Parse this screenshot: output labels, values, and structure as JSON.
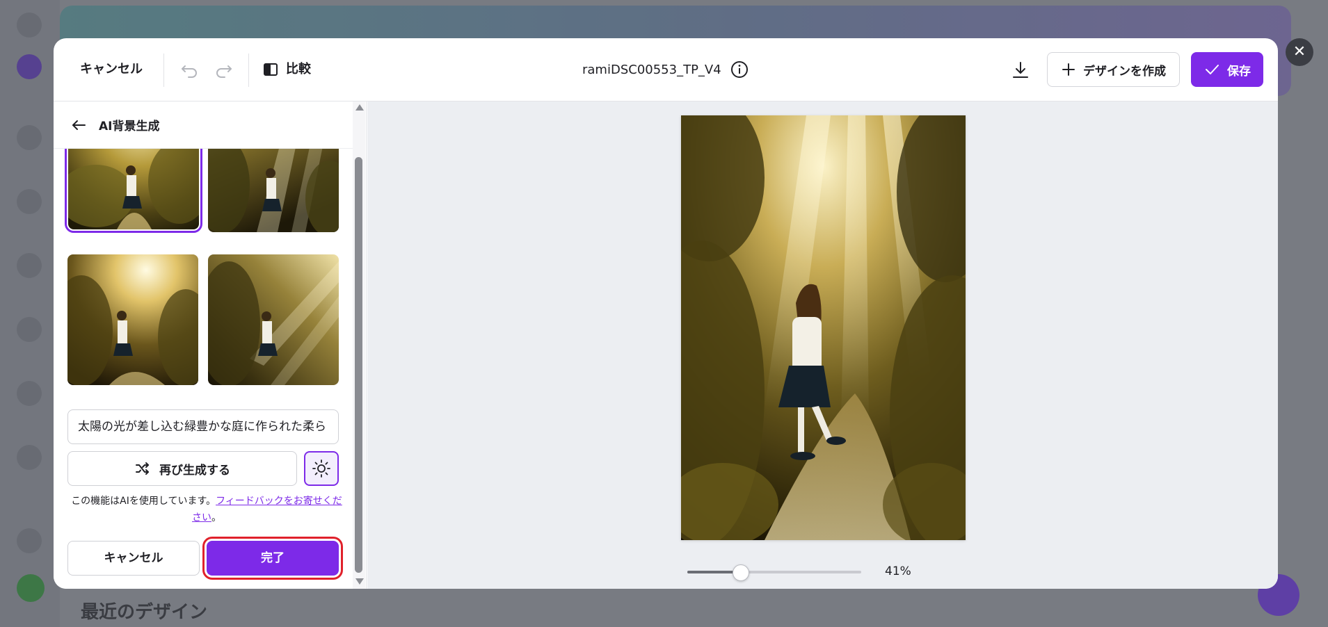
{
  "background": {
    "heading": "最近のデザイン"
  },
  "topbar": {
    "cancel_label": "キャンセル",
    "compare_label": "比較",
    "file_title": "ramiDSC00553_TP_V4",
    "create_design_label": "デザインを作成",
    "save_label": "保存"
  },
  "panel": {
    "title": "AI背景生成",
    "thumbnails": [
      {
        "label": "variation-1",
        "selected": true
      },
      {
        "label": "variation-2",
        "selected": false
      },
      {
        "label": "variation-3",
        "selected": false
      },
      {
        "label": "variation-4",
        "selected": false
      }
    ],
    "prompt_value": "太陽の光が差し込む緑豊かな庭に作られた柔ら",
    "regenerate_label": "再び生成する",
    "ai_note_text": "この機能はAIを使用しています。",
    "feedback_link": "フィードバックをお寄せください",
    "ai_note_end": "。",
    "cancel_label": "キャンセル",
    "done_label": "完了"
  },
  "canvas": {
    "zoom_label": "41%",
    "zoom_level": 0.41
  },
  "colors": {
    "accent": "#7d2ae8",
    "highlight": "#e0212b"
  },
  "icons": {
    "close": "close-icon",
    "undo": "undo-icon",
    "redo": "redo-icon",
    "compare": "compare-icon",
    "info": "info-icon",
    "download": "download-icon",
    "plus": "plus-icon",
    "check": "check-icon",
    "back": "arrow-left-icon",
    "shuffle": "shuffle-icon",
    "sun": "sun-icon"
  }
}
